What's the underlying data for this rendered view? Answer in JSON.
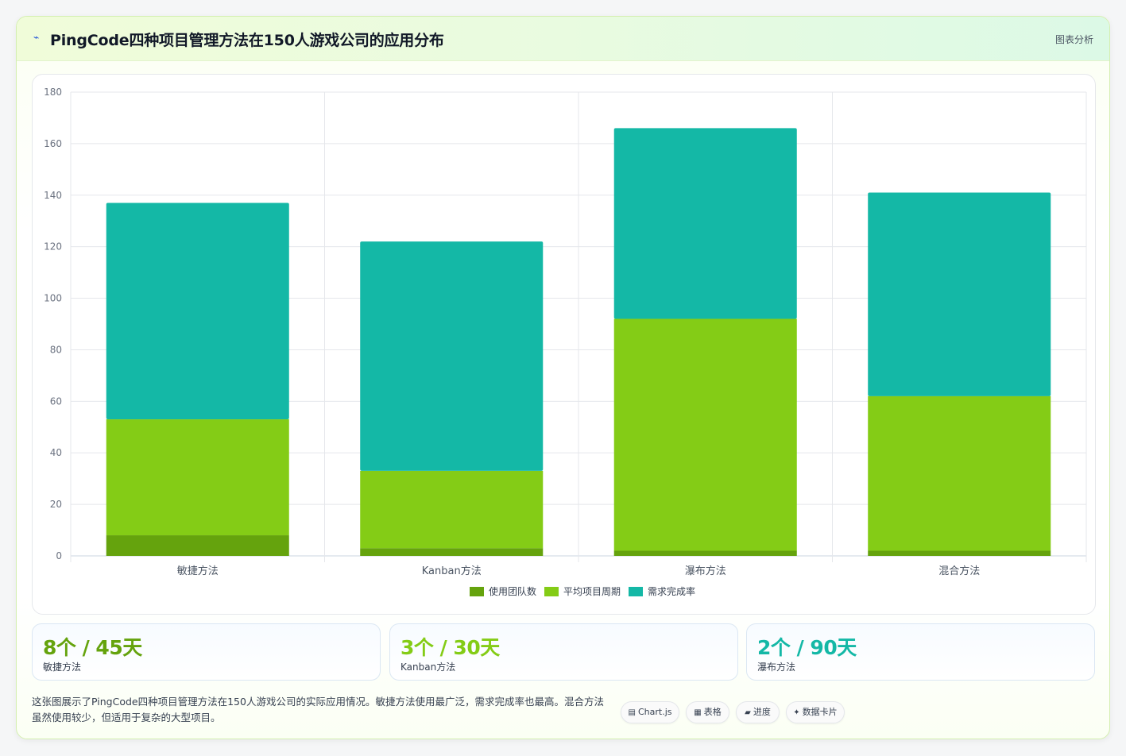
{
  "header": {
    "title": "PingCode四种项目管理方法在150人游戏公司的应用分布",
    "tag": "图表分析"
  },
  "colors": {
    "series1": "#65a30d",
    "series2": "#84cc16",
    "series3": "#14b8a6"
  },
  "chart_data": {
    "type": "bar",
    "stacked": true,
    "categories": [
      "敏捷方法",
      "Kanban方法",
      "瀑布方法",
      "混合方法"
    ],
    "series": [
      {
        "name": "使用团队数",
        "values": [
          8,
          3,
          2,
          2
        ],
        "color": "#65a30d"
      },
      {
        "name": "平均项目周期",
        "values": [
          45,
          30,
          90,
          60
        ],
        "color": "#84cc16"
      },
      {
        "name": "需求完成率",
        "values": [
          84,
          89,
          74,
          79
        ],
        "color": "#14b8a6"
      }
    ],
    "ylim": [
      0,
      180
    ],
    "yticks": [
      0,
      20,
      40,
      60,
      80,
      100,
      120,
      140,
      160,
      180
    ],
    "title": "",
    "xlabel": "",
    "ylabel": "",
    "grid": true,
    "legend": "bottom-center"
  },
  "stats": [
    {
      "value": "8个 / 45天",
      "label": "敏捷方法",
      "color": "#65a30d"
    },
    {
      "value": "3个 / 30天",
      "label": "Kanban方法",
      "color": "#84cc16"
    },
    {
      "value": "2个 / 90天",
      "label": "瀑布方法",
      "color": "#14b8a6"
    }
  ],
  "description": "这张图展示了PingCode四种项目管理方法在150人游戏公司的实际应用情况。敏捷方法使用最广泛，需求完成率也最高。混合方法虽然使用较少，但适用于复杂的大型项目。",
  "pills": [
    {
      "icon": "▤",
      "label": "Chart.js"
    },
    {
      "icon": "▦",
      "label": "表格"
    },
    {
      "icon": "▰",
      "label": "进度"
    },
    {
      "icon": "✦",
      "label": "数据卡片"
    }
  ]
}
